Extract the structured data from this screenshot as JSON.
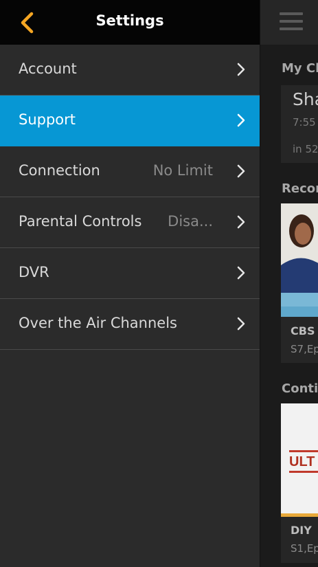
{
  "header": {
    "title": "Settings",
    "back_icon": "chevron-left-icon",
    "accent": "#f5a623"
  },
  "menu": {
    "items": [
      {
        "label": "Account",
        "value": ""
      },
      {
        "label": "Support",
        "value": "",
        "active": true
      },
      {
        "label": "Connection",
        "value": "No Limit"
      },
      {
        "label": "Parental Controls",
        "value": "Disa..."
      },
      {
        "label": "DVR",
        "value": ""
      },
      {
        "label": "Over the Air Channels",
        "value": ""
      }
    ],
    "active_color": "#0797d4"
  },
  "background": {
    "my_channels": {
      "title": "My Ch",
      "card_title": "Sha",
      "card_time": "7:55",
      "card_sub": "in 52"
    },
    "recordings": {
      "title": "Recor",
      "caption": "CBS",
      "sub": "S7,Ep"
    },
    "continue": {
      "title": "Conti",
      "caption": "DIY",
      "sub": "S1,Ep",
      "logo_text": "ULT"
    }
  }
}
